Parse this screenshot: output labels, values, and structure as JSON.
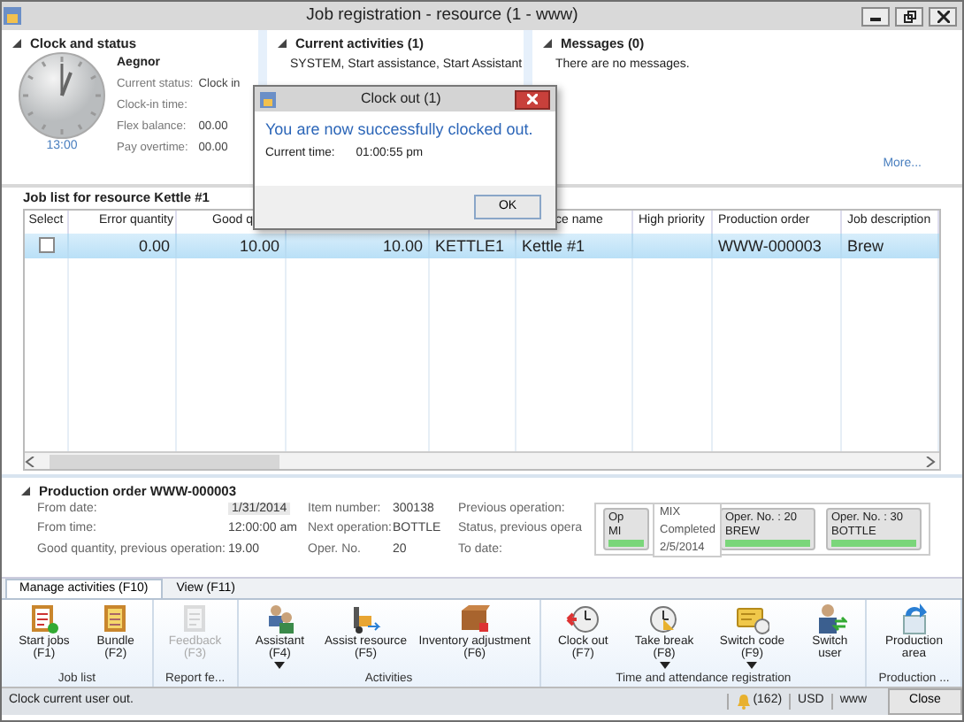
{
  "window": {
    "title": "Job registration - resource (1 - www)"
  },
  "clock_status": {
    "title": "Clock and status",
    "time": "13:00",
    "worker": "Aegnor",
    "fields": [
      {
        "label": "Current status:",
        "value": "Clock in"
      },
      {
        "label": "Clock-in time:"
      },
      {
        "label": "Flex balance:",
        "value": "00.00"
      },
      {
        "label": "Pay overtime:",
        "value": "00.00"
      }
    ]
  },
  "current_activities": {
    "title": "Current activities (1)",
    "text": "SYSTEM, Start assistance, Start Assistant"
  },
  "messages": {
    "title": "Messages (0)",
    "text": "There are no messages.",
    "more": "More..."
  },
  "dialog": {
    "title": "Clock out (1)",
    "message": "You are now successfully clocked out.",
    "label": "Current time:",
    "value": "01:00:55 pm",
    "button": "OK"
  },
  "job_list": {
    "title": "Job list for resource Kettle #1",
    "columns": [
      "Select",
      "Error quantity",
      "Good q",
      "",
      "",
      "ce name",
      "High priority",
      "Production order",
      "Job description"
    ],
    "rows": [
      {
        "selected": true,
        "checked": false,
        "cells": [
          "",
          "0.00",
          "10.00",
          "10.00",
          "KETTLE1",
          "Kettle #1",
          "",
          "WWW-000003",
          "Brew"
        ]
      }
    ]
  },
  "production_order": {
    "title": "Production order WWW-000003",
    "fields_left": [
      {
        "label": "From date:",
        "value": "1/31/2014",
        "kind": "field"
      },
      {
        "label": "From time:",
        "value": "12:00:00 am",
        "kind": "text"
      },
      {
        "label": "Good quantity, previous operation:",
        "value": "19.00",
        "kind": "text"
      }
    ],
    "fields_mid": [
      {
        "label": "Item number:",
        "value": "300138"
      },
      {
        "label": "Next operation:",
        "value": "BOTTLE"
      },
      {
        "label": "Oper. No.",
        "value": "20"
      }
    ],
    "fields_right": [
      "Previous operation:",
      "Status, previous opera",
      "To date:"
    ],
    "tooltip": [
      "MIX",
      "Completed",
      "2/5/2014"
    ],
    "operations": [
      {
        "title": "Op",
        "name": "MI",
        "level": 1
      },
      {
        "title": "Oper. No. : 20",
        "name": "BREW",
        "level": 1
      },
      {
        "title": "Oper. No. : 30",
        "name": "BOTTLE",
        "level": 1
      }
    ]
  },
  "ribbon": {
    "tabs": [
      {
        "label": "Manage activities (F10)",
        "selected": true
      },
      {
        "label": "View (F11)",
        "selected": false
      }
    ],
    "groups": [
      {
        "label": "Job list",
        "buttons": [
          {
            "label": "Start jobs (F1)",
            "disabled": false,
            "dropdown": false
          },
          {
            "label": "Bundle (F2)",
            "disabled": false,
            "dropdown": false
          }
        ]
      },
      {
        "label": "Report fe...",
        "buttons": [
          {
            "label": "Feedback (F3)",
            "disabled": true,
            "dropdown": false
          }
        ]
      },
      {
        "label": "Activities",
        "buttons": [
          {
            "label": "Assistant (F4)",
            "disabled": false,
            "dropdown": true
          },
          {
            "label": "Assist resource (F5)",
            "disabled": false,
            "dropdown": false
          },
          {
            "label": "Inventory adjustment (F6)",
            "disabled": false,
            "dropdown": false
          }
        ]
      },
      {
        "label": "Time and attendance registration",
        "buttons": [
          {
            "label": "Clock out (F7)",
            "disabled": false,
            "dropdown": false
          },
          {
            "label": "Take break (F8)",
            "disabled": false,
            "dropdown": true
          },
          {
            "label": "Switch code (F9)",
            "disabled": false,
            "dropdown": true
          },
          {
            "label": "Switch user",
            "disabled": false,
            "dropdown": false
          }
        ]
      },
      {
        "label": "Production ...",
        "buttons": [
          {
            "label": "Production area",
            "disabled": false,
            "dropdown": false
          }
        ]
      }
    ]
  },
  "status_bar": {
    "text": "Clock current user out.",
    "notifications": "(162)",
    "currency": "USD",
    "company": "www",
    "close": "Close"
  }
}
